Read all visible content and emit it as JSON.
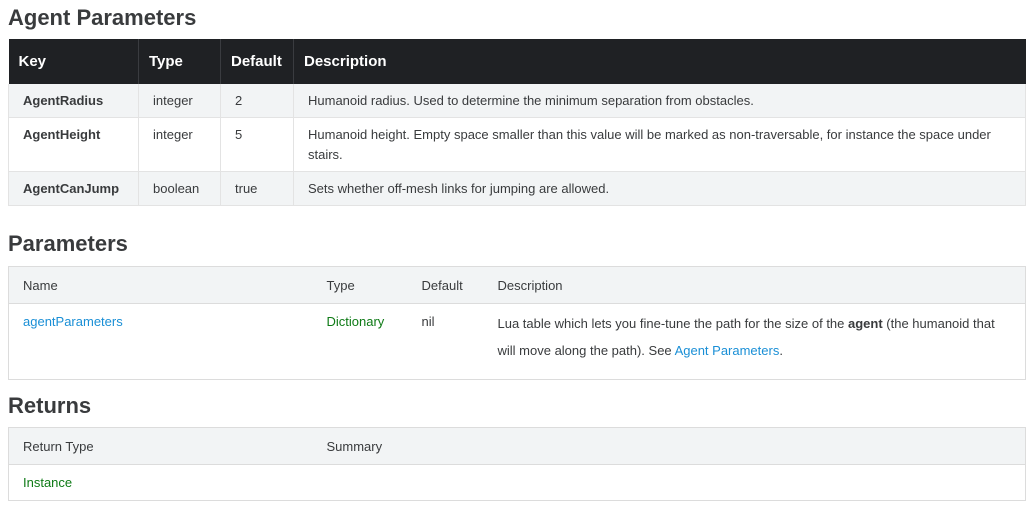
{
  "agent_section": {
    "title": "Agent Parameters",
    "headers": [
      "Key",
      "Type",
      "Default",
      "Description"
    ],
    "rows": [
      {
        "key": "AgentRadius",
        "type": "integer",
        "default": "2",
        "description": "Humanoid radius. Used to determine the minimum separation from obstacles."
      },
      {
        "key": "AgentHeight",
        "type": "integer",
        "default": "5",
        "description": "Humanoid height. Empty space smaller than this value will be marked as non-traversable, for instance the space under stairs."
      },
      {
        "key": "AgentCanJump",
        "type": "boolean",
        "default": "true",
        "description": "Sets whether off-mesh links for jumping are allowed."
      }
    ]
  },
  "parameters_section": {
    "title": "Parameters",
    "headers": {
      "name": "Name",
      "type": "Type",
      "default": "Default",
      "description": "Description"
    },
    "row": {
      "name": "agentParameters",
      "type": "Dictionary",
      "default": "nil",
      "description_pre": "Lua table which lets you fine-tune the path for the size of the ",
      "description_bold": "agent",
      "description_mid": " (the humanoid that will move along the path). See ",
      "description_link": "Agent Parameters",
      "description_post": "."
    }
  },
  "returns_section": {
    "title": "Returns",
    "headers": {
      "return_type": "Return Type",
      "summary": "Summary"
    },
    "row": {
      "return_type": "Instance",
      "summary": ""
    }
  },
  "colors": {
    "link": "#1a8fd6",
    "type_green": "#0e7a16",
    "header_dark": "#1f2124"
  }
}
